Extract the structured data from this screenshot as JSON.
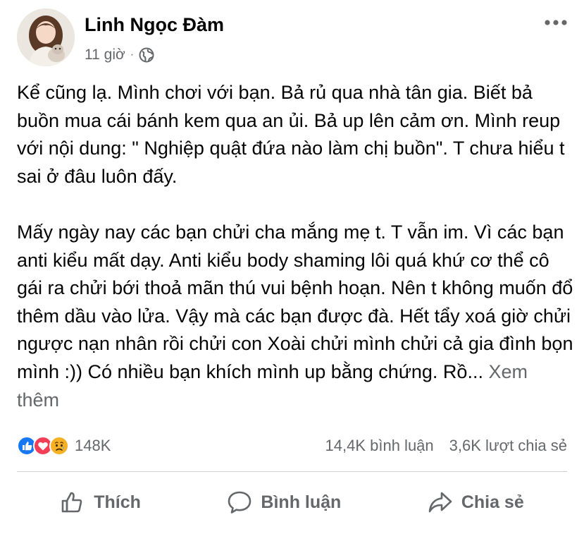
{
  "post": {
    "author": "Linh Ngọc Đàm",
    "time": "11 giờ",
    "separator": "·",
    "privacy_icon": "globe-icon",
    "paragraphs": [
      "Kể cũng lạ. Mình chơi với bạn. Bả rủ qua nhà tân gia. Biết bả buồn mua cái bánh kem qua an ủi. Bả up lên cảm ơn. Mình reup với nội dung: \" Nghiệp quật đứa nào làm chị buồn\". T chưa hiểu t sai ở đâu luôn đấy.",
      "Mấy ngày nay các bạn chửi cha mắng mẹ t. T vẫn im. Vì các bạn anti kiểu mất dạy. Anti kiểu body shaming lôi quá khứ cơ thể cô gái ra chửi bới thoả mãn thú vui bệnh hoạn. Nên t không muốn đổ thêm dầu vào lửa. Vậy mà các bạn được đà. Hết tẩy xoá giờ chửi ngược nạn nhân rồi chửi con Xoài chửi mình chửi cả gia đình bọn mình :)) Có nhiều bạn khích mình up bằng chứng. Rồ..."
    ],
    "see_more": "Xem thêm"
  },
  "stats": {
    "reactions": [
      "like",
      "love",
      "sad"
    ],
    "reaction_count": "148K",
    "comments": "14,4K bình luận",
    "shares": "3,6K lượt chia sẻ"
  },
  "actions": {
    "like": "Thích",
    "comment": "Bình luận",
    "share": "Chia sẻ"
  },
  "colors": {
    "secondary_text": "#65676b",
    "like_blue": "#1877f2",
    "love_red": "#f33e58",
    "sad_yellow": "#f7b125"
  }
}
